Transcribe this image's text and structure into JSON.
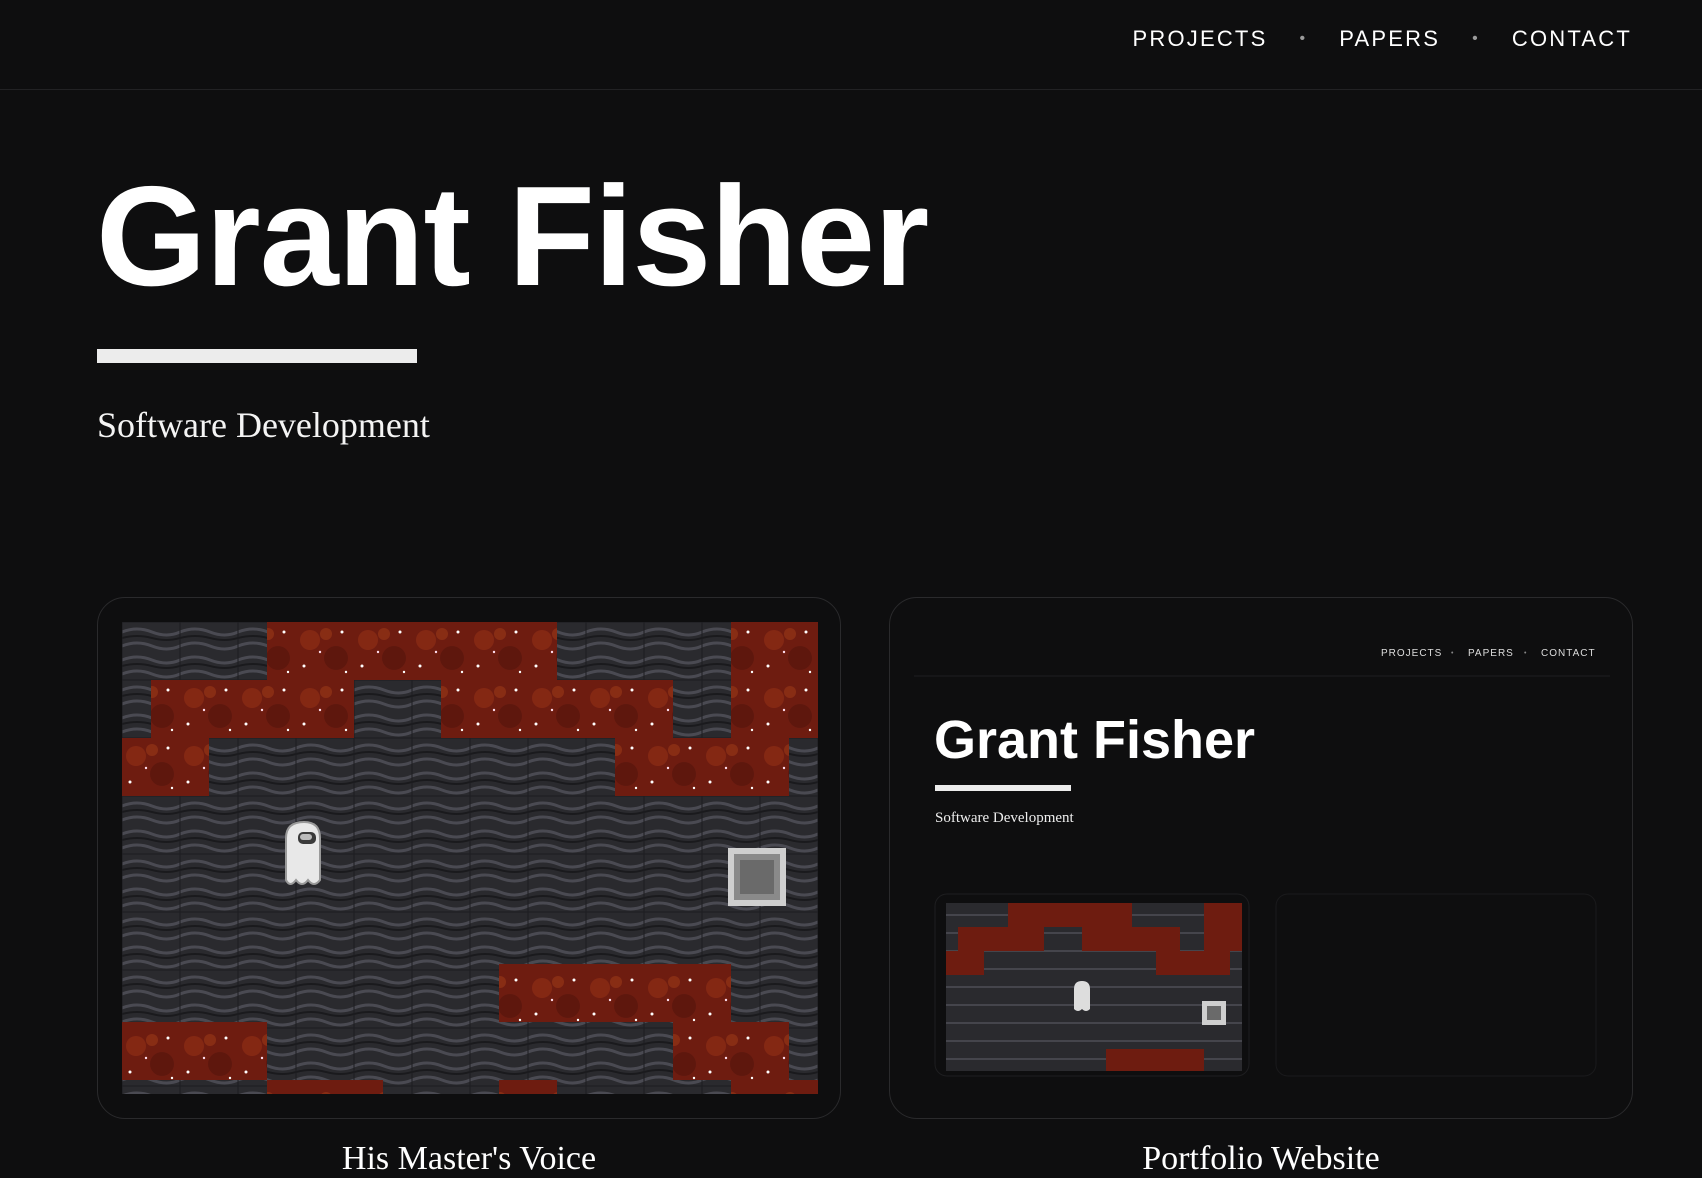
{
  "nav": {
    "items": [
      {
        "label": "PROJECTS"
      },
      {
        "label": "PAPERS"
      },
      {
        "label": "CONTACT"
      }
    ],
    "separator": "•"
  },
  "hero": {
    "name": "Grant Fisher",
    "subtitle": "Software Development"
  },
  "projects": [
    {
      "title": "His Master's Voice"
    },
    {
      "title": "Portfolio Website"
    }
  ],
  "preview": {
    "nav_items": [
      "PROJECTS",
      "PAPERS",
      "CONTACT"
    ],
    "name": "Grant Fisher",
    "subtitle": "Software Development"
  },
  "colors": {
    "background": "#0e0e0f",
    "lava": "#7a1f12",
    "stone": "#2c2c30",
    "accent_rule": "#ececec"
  }
}
